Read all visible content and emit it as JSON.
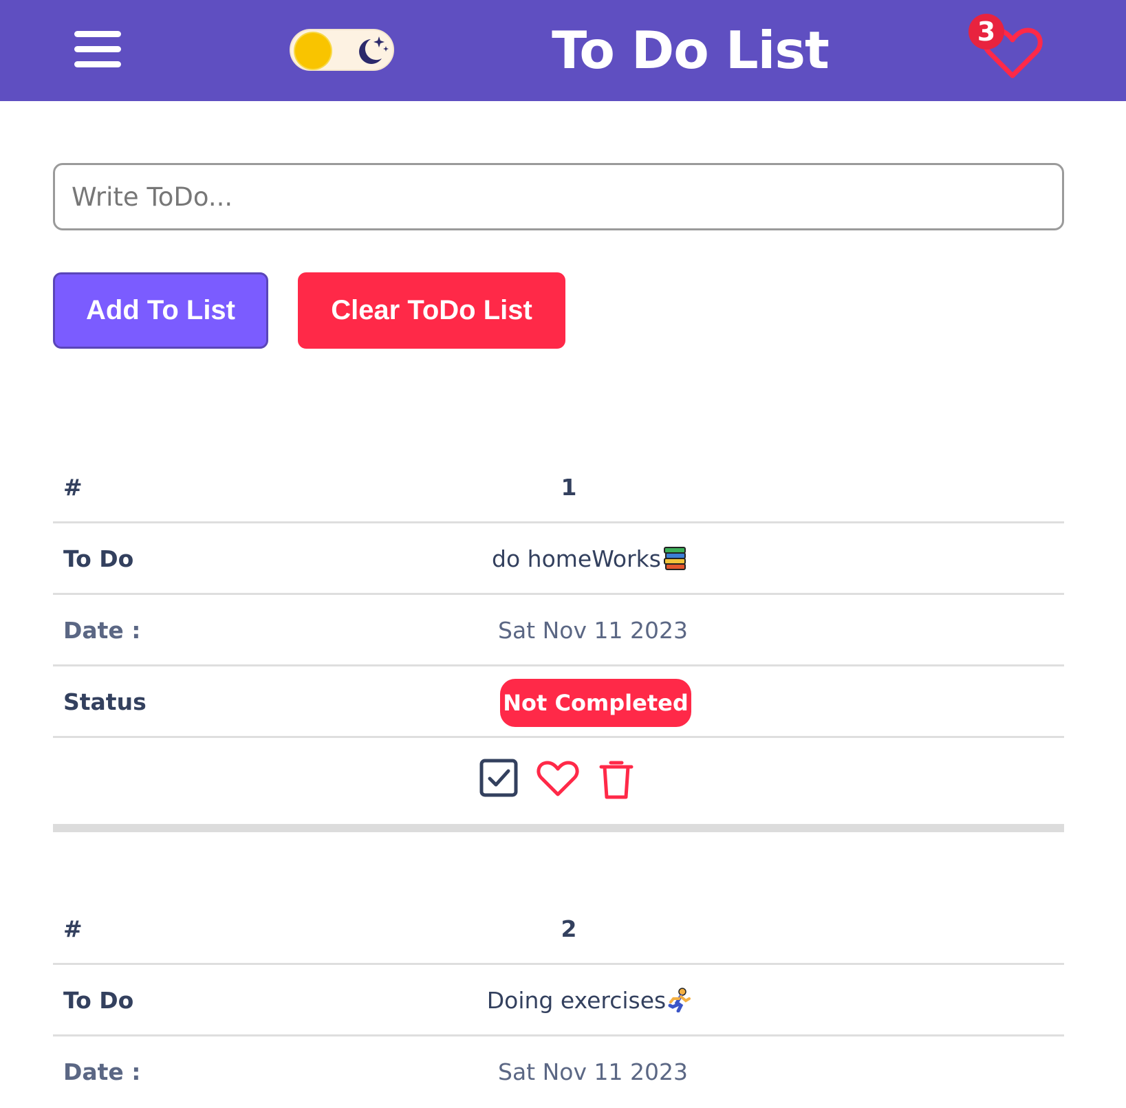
{
  "header": {
    "title": "To Do List",
    "favorites_count": "3",
    "menu_icon": "hamburger-menu-icon",
    "theme_icon": "sun-moon-toggle-icon"
  },
  "input": {
    "placeholder": "Write ToDo...",
    "value": ""
  },
  "buttons": {
    "add_label": "Add To List",
    "clear_label": "Clear ToDo List"
  },
  "labels": {
    "number": "#",
    "todo": "To Do",
    "date": "Date :",
    "status": "Status"
  },
  "todos": [
    {
      "number": "1",
      "text": "do homeWorks",
      "emoji": "books",
      "date": "Sat Nov 11 2023",
      "status": "Not Completed"
    },
    {
      "number": "2",
      "text": "Doing exercises",
      "emoji": "running-person",
      "date": "Sat Nov 11 2023",
      "status": ""
    }
  ],
  "colors": {
    "header_bg": "#5f4fc1",
    "add_button": "#7b5cff",
    "clear_button": "#ff2948",
    "status_not_completed": "#ff2948",
    "text_dark": "#33405e"
  }
}
